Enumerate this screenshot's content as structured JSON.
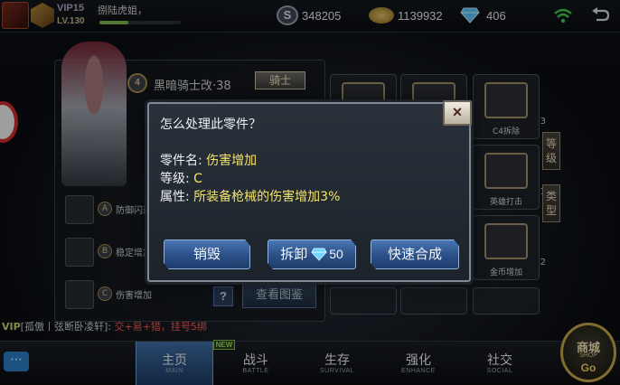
{
  "topbar": {
    "vip": "VIP15",
    "player_name": "捌陆虎姐，",
    "level": "LV.130",
    "exp_fraction": 0.35,
    "coin_s_label": "S",
    "coin_s": "348205",
    "gold": "1139932",
    "diamonds": "406"
  },
  "weapon": {
    "emblem": "4",
    "name": "黑暗骑士改·38",
    "badge": "骑士"
  },
  "skills": [
    {
      "circle": "A",
      "label": "防御闪避"
    },
    {
      "circle": "B",
      "label": "稳定增加"
    },
    {
      "circle": "C",
      "label": "伤害增加"
    }
  ],
  "help_label": "?",
  "gallery_button": "查看图鉴",
  "slots": [
    {
      "label": "C4拆除",
      "count": "3"
    },
    {
      "label": "英雄打击",
      "count": "1"
    },
    {
      "label": "金币增加",
      "count": "2"
    }
  ],
  "side_tabs": [
    "等级",
    "类型"
  ],
  "chat": {
    "vip": "VIP",
    "text": "[孤傲丨弦断卧凌轩]:",
    "highlight": "交+易+猎，挂号5",
    "tail": "绑"
  },
  "nav": [
    {
      "label": "主页",
      "sub": "MAIN"
    },
    {
      "label": "战斗",
      "sub": "BATTLE"
    },
    {
      "label": "生存",
      "sub": "SURVIVAL"
    },
    {
      "label": "强化",
      "sub": "ENHANCE"
    },
    {
      "label": "社交",
      "sub": "SOCIAL"
    }
  ],
  "nav_new_badge": "NEW",
  "shop": {
    "label": "商城",
    "sub": "SHOP",
    "go": "Go"
  },
  "dialog": {
    "title": "怎么处理此零件？",
    "name_label": "零件名:",
    "name_value": "伤害增加",
    "grade_label": "等级:",
    "grade_value": "C",
    "attr_label": "属性:",
    "attr_value": "所装备枪械的伤害增加3%",
    "close": "×",
    "destroy_button": "销毁",
    "dismantle_button": "拆卸",
    "dismantle_cost": "50",
    "synth_button": "快速合成"
  },
  "icons": {
    "close": "close-icon",
    "diamond": "diamond-icon",
    "wifi": "wifi-icon",
    "back": "back-icon",
    "gold_coin": "gold-coin-icon",
    "chat": "chat-icon"
  },
  "colors": {
    "accent_blue": "#2b4f86",
    "value_yellow": "#f1e36a",
    "chat_red": "#ff5b4e"
  }
}
